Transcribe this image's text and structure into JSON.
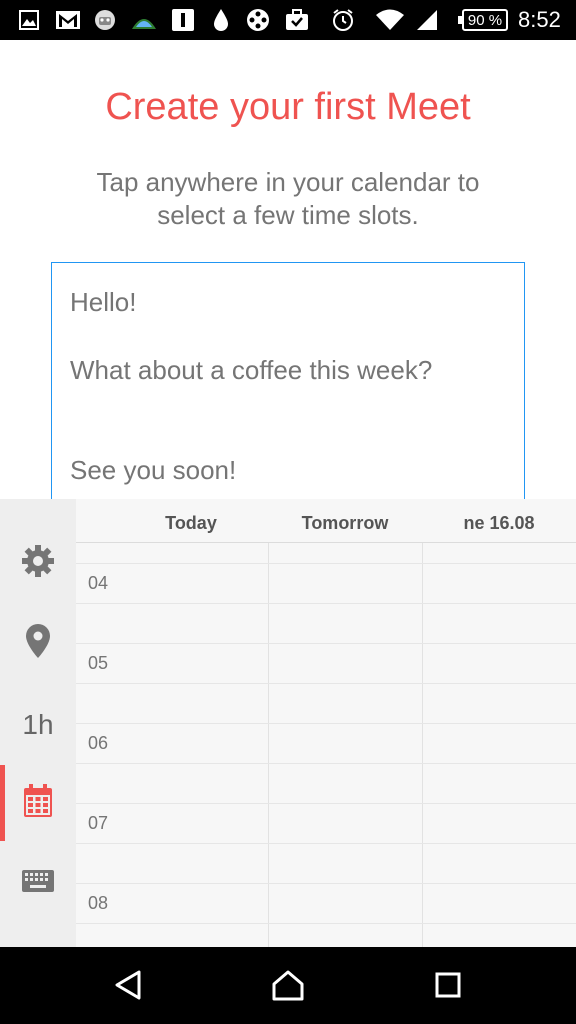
{
  "status_bar": {
    "time": "8:52",
    "battery": "90 %",
    "icons": [
      "gallery-icon",
      "gmail-icon",
      "robot-icon",
      "mountain-icon",
      "sim-icon",
      "drop-icon",
      "film-icon",
      "briefcase-icon",
      "alarm-icon",
      "wifi-icon",
      "signal-icon"
    ]
  },
  "header": {
    "title": "Create your first Meet",
    "subtitle": "Tap anywhere in your calendar to select a few time slots."
  },
  "message": {
    "line1": "Hello!",
    "line2": "What about a coffee this week?",
    "line3": "See you soon!"
  },
  "sidebar": {
    "items": [
      {
        "name": "settings",
        "icon": "gear-icon"
      },
      {
        "name": "location",
        "icon": "location-pin-icon"
      },
      {
        "name": "duration",
        "label": "1h"
      },
      {
        "name": "calendar",
        "icon": "calendar-icon",
        "active": true
      },
      {
        "name": "keyboard",
        "icon": "keyboard-icon"
      }
    ],
    "accent": "#ef5350"
  },
  "calendar": {
    "days": [
      "Today",
      "Tomorrow",
      "ne 16.08"
    ],
    "hours": [
      "04",
      "05",
      "06",
      "07",
      "08"
    ]
  },
  "colors": {
    "title": "#ef5350",
    "input_border": "#2196f3",
    "text_gray": "#757575"
  }
}
